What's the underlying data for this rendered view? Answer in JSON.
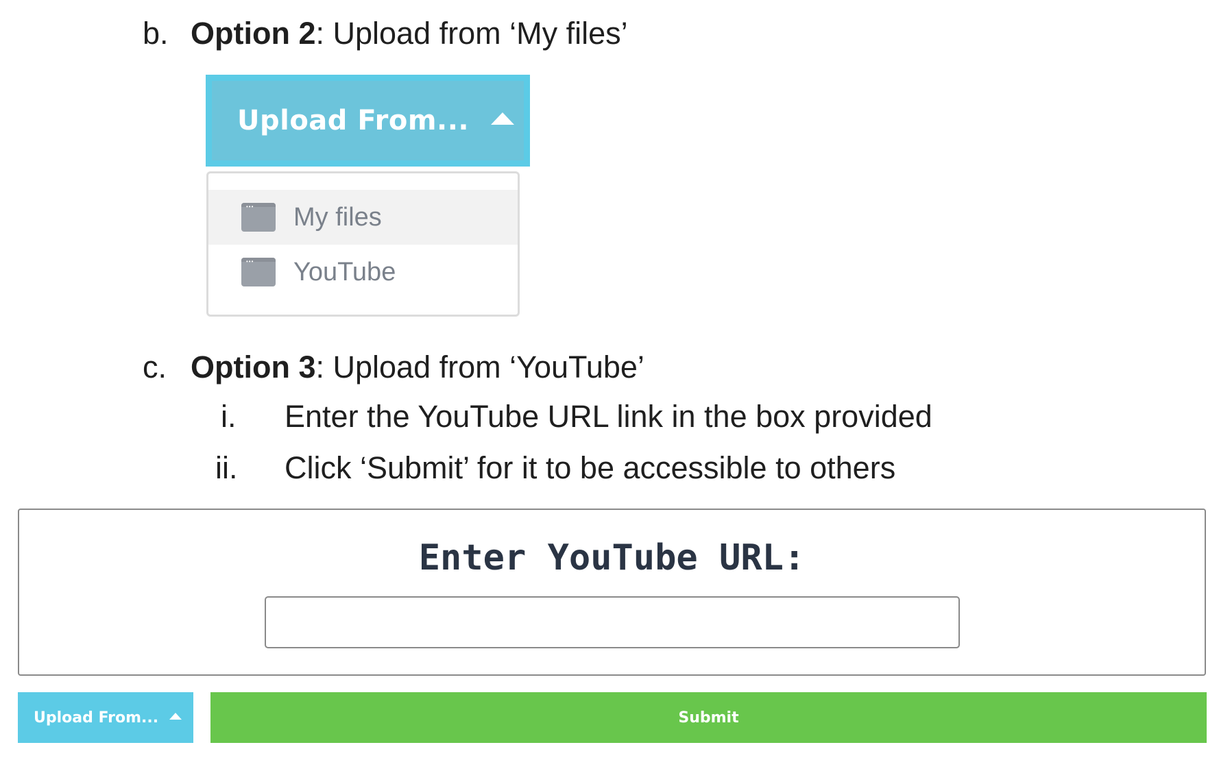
{
  "option2": {
    "marker": "b.",
    "bold": "Option 2",
    "rest": ": Upload from ‘My files’"
  },
  "upload_button_large": {
    "label": "Upload From..."
  },
  "dropdown": {
    "items": [
      {
        "label": "My files",
        "icon": "window-icon",
        "highlighted": true
      },
      {
        "label": "YouTube",
        "icon": "window-icon",
        "highlighted": false
      }
    ]
  },
  "option3": {
    "marker": "c.",
    "bold": "Option 3",
    "rest": ": Upload from ‘YouTube’",
    "steps": [
      {
        "marker": "i.",
        "text": "Enter the YouTube URL link in the box provided"
      },
      {
        "marker": "ii.",
        "text": "Click ‘Submit’ for it to be accessible to others"
      }
    ]
  },
  "url_panel": {
    "title": "Enter YouTube URL:",
    "input_value": "",
    "input_placeholder": ""
  },
  "bottom_bar": {
    "upload_label": "Upload From...",
    "submit_label": "Submit"
  },
  "colors": {
    "upload_blue": "#5ccbe6",
    "submit_green": "#68c64c",
    "title_navy": "#2a3444"
  }
}
